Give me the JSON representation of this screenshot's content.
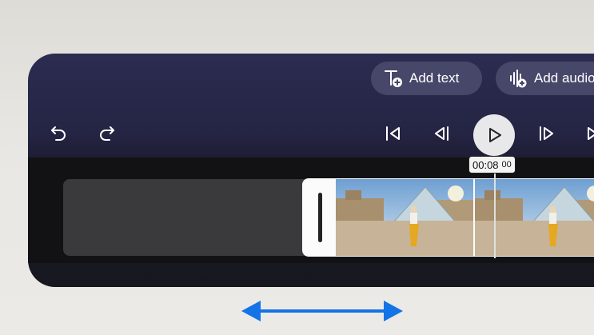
{
  "toolbar": {
    "add_text_label": "Add text",
    "add_audio_label": "Add audio"
  },
  "playback": {
    "timecode": "00:08",
    "frames": "00"
  },
  "icons": {
    "undo": "undo-icon",
    "redo": "redo-icon",
    "skip_start": "skip-to-start-icon",
    "prev_frame": "previous-frame-icon",
    "play": "play-icon",
    "next_frame": "next-frame-icon",
    "skip_end": "skip-to-end-icon",
    "add_text": "text-add-icon",
    "add_audio": "audio-add-icon",
    "trim_arrow": "double-arrow-icon"
  },
  "colors": {
    "panel": "#242443",
    "accent_arrow": "#1473e6",
    "pill": "#47476a"
  }
}
